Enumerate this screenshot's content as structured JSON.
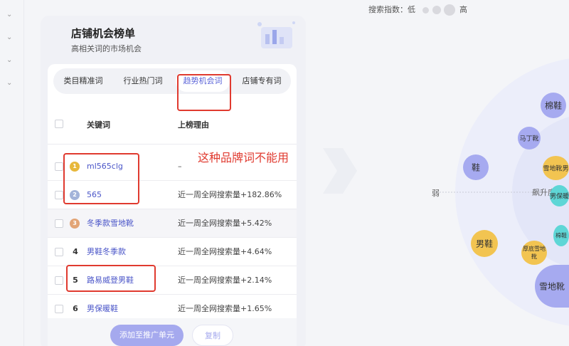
{
  "panel": {
    "title": "店铺机会榜单",
    "subtitle": "高相关词的市场机会",
    "tabs": [
      {
        "label": "类目精准词",
        "active": false
      },
      {
        "label": "行业热门词",
        "active": false
      },
      {
        "label": "趋势机会词",
        "active": true
      },
      {
        "label": "店铺专有词",
        "active": false
      }
    ],
    "columns": {
      "keyword": "关键词",
      "reason": "上榜理由"
    },
    "rows": [
      {
        "rank": "1",
        "medal": "gold-medal-icon",
        "keyword": "ml565clg",
        "reason": "–"
      },
      {
        "rank": "2",
        "medal": "silver-medal-icon",
        "keyword": "565",
        "reason": "近一周全网搜索量+182.86%"
      },
      {
        "rank": "3",
        "medal": "bronze-medal-icon",
        "keyword": "冬季款雪地靴",
        "reason": "近一周全网搜索量+5.42%"
      },
      {
        "rank": "4",
        "keyword": "男鞋冬季款",
        "reason": "近一周全网搜索量+4.64%"
      },
      {
        "rank": "5",
        "keyword": "路易威登男鞋",
        "reason": "近一周全网搜索量+2.14%"
      },
      {
        "rank": "6",
        "keyword": "男保暖鞋",
        "reason": "近一周全网搜索量+1.65%"
      }
    ],
    "buttons": {
      "add": "添加至推广单元",
      "copy": "复制"
    }
  },
  "annotation": "这种品牌词不能用",
  "legend": {
    "label": "搜索指数：",
    "low": "低",
    "high": "高"
  },
  "axis": {
    "weak": "弱",
    "rise": "飙升度"
  },
  "bubbles": [
    {
      "label": "棉鞋",
      "color": "purple"
    },
    {
      "label": "马丁靴",
      "color": "purple"
    },
    {
      "label": "鞋",
      "color": "purple"
    },
    {
      "label": "雪地靴男",
      "color": "yellow"
    },
    {
      "label": "男保暖",
      "color": "teal"
    },
    {
      "label": "男鞋",
      "color": "yellow"
    },
    {
      "label": "厚底雪地靴",
      "color": "yellow"
    },
    {
      "label": "棉鞋",
      "color": "teal"
    },
    {
      "label": "雪地靴",
      "color": "purple"
    }
  ],
  "colors": {
    "accent": "#5a63d8",
    "annotation": "#e03a2f",
    "bubble_purple": "#a6aaf0",
    "bubble_yellow": "#f2c451",
    "bubble_teal": "#5ed6d6"
  }
}
